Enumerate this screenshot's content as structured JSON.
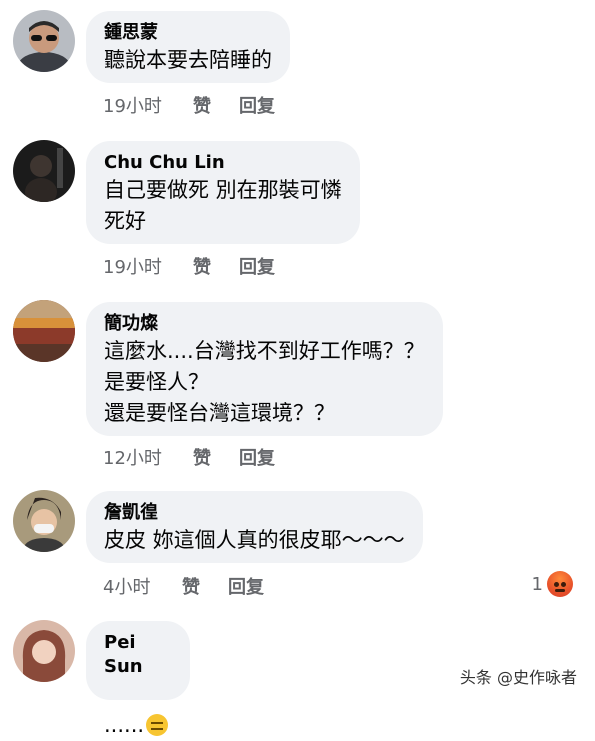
{
  "comments": [
    {
      "author": "鍾思蒙",
      "text": "聽說本要去陪睡的",
      "time": "19小时",
      "like": "赞",
      "reply": "回复"
    },
    {
      "author": "Chu Chu Lin",
      "text": "自己要做死 別在那裝可憐\n死好",
      "time": "19小时",
      "like": "赞",
      "reply": "回复"
    },
    {
      "author": "簡功燦",
      "text": "這麼水....台灣找不到好工作嗎？？\n是要怪人？\n還是要怪台灣這環境？？",
      "time": "12小时",
      "like": "赞",
      "reply": "回复"
    },
    {
      "author": "詹凱徨",
      "text": "皮皮 妳這個人真的很皮耶～～～",
      "time": "4小时",
      "like": "赞",
      "reply": "回复",
      "reaction_count": "1",
      "reaction_icon": "angry-reaction-icon"
    },
    {
      "author": "Pei Sun",
      "text": "......",
      "emoji": "expressionless-face"
    }
  ],
  "watermark": "头条 @史作咏者"
}
